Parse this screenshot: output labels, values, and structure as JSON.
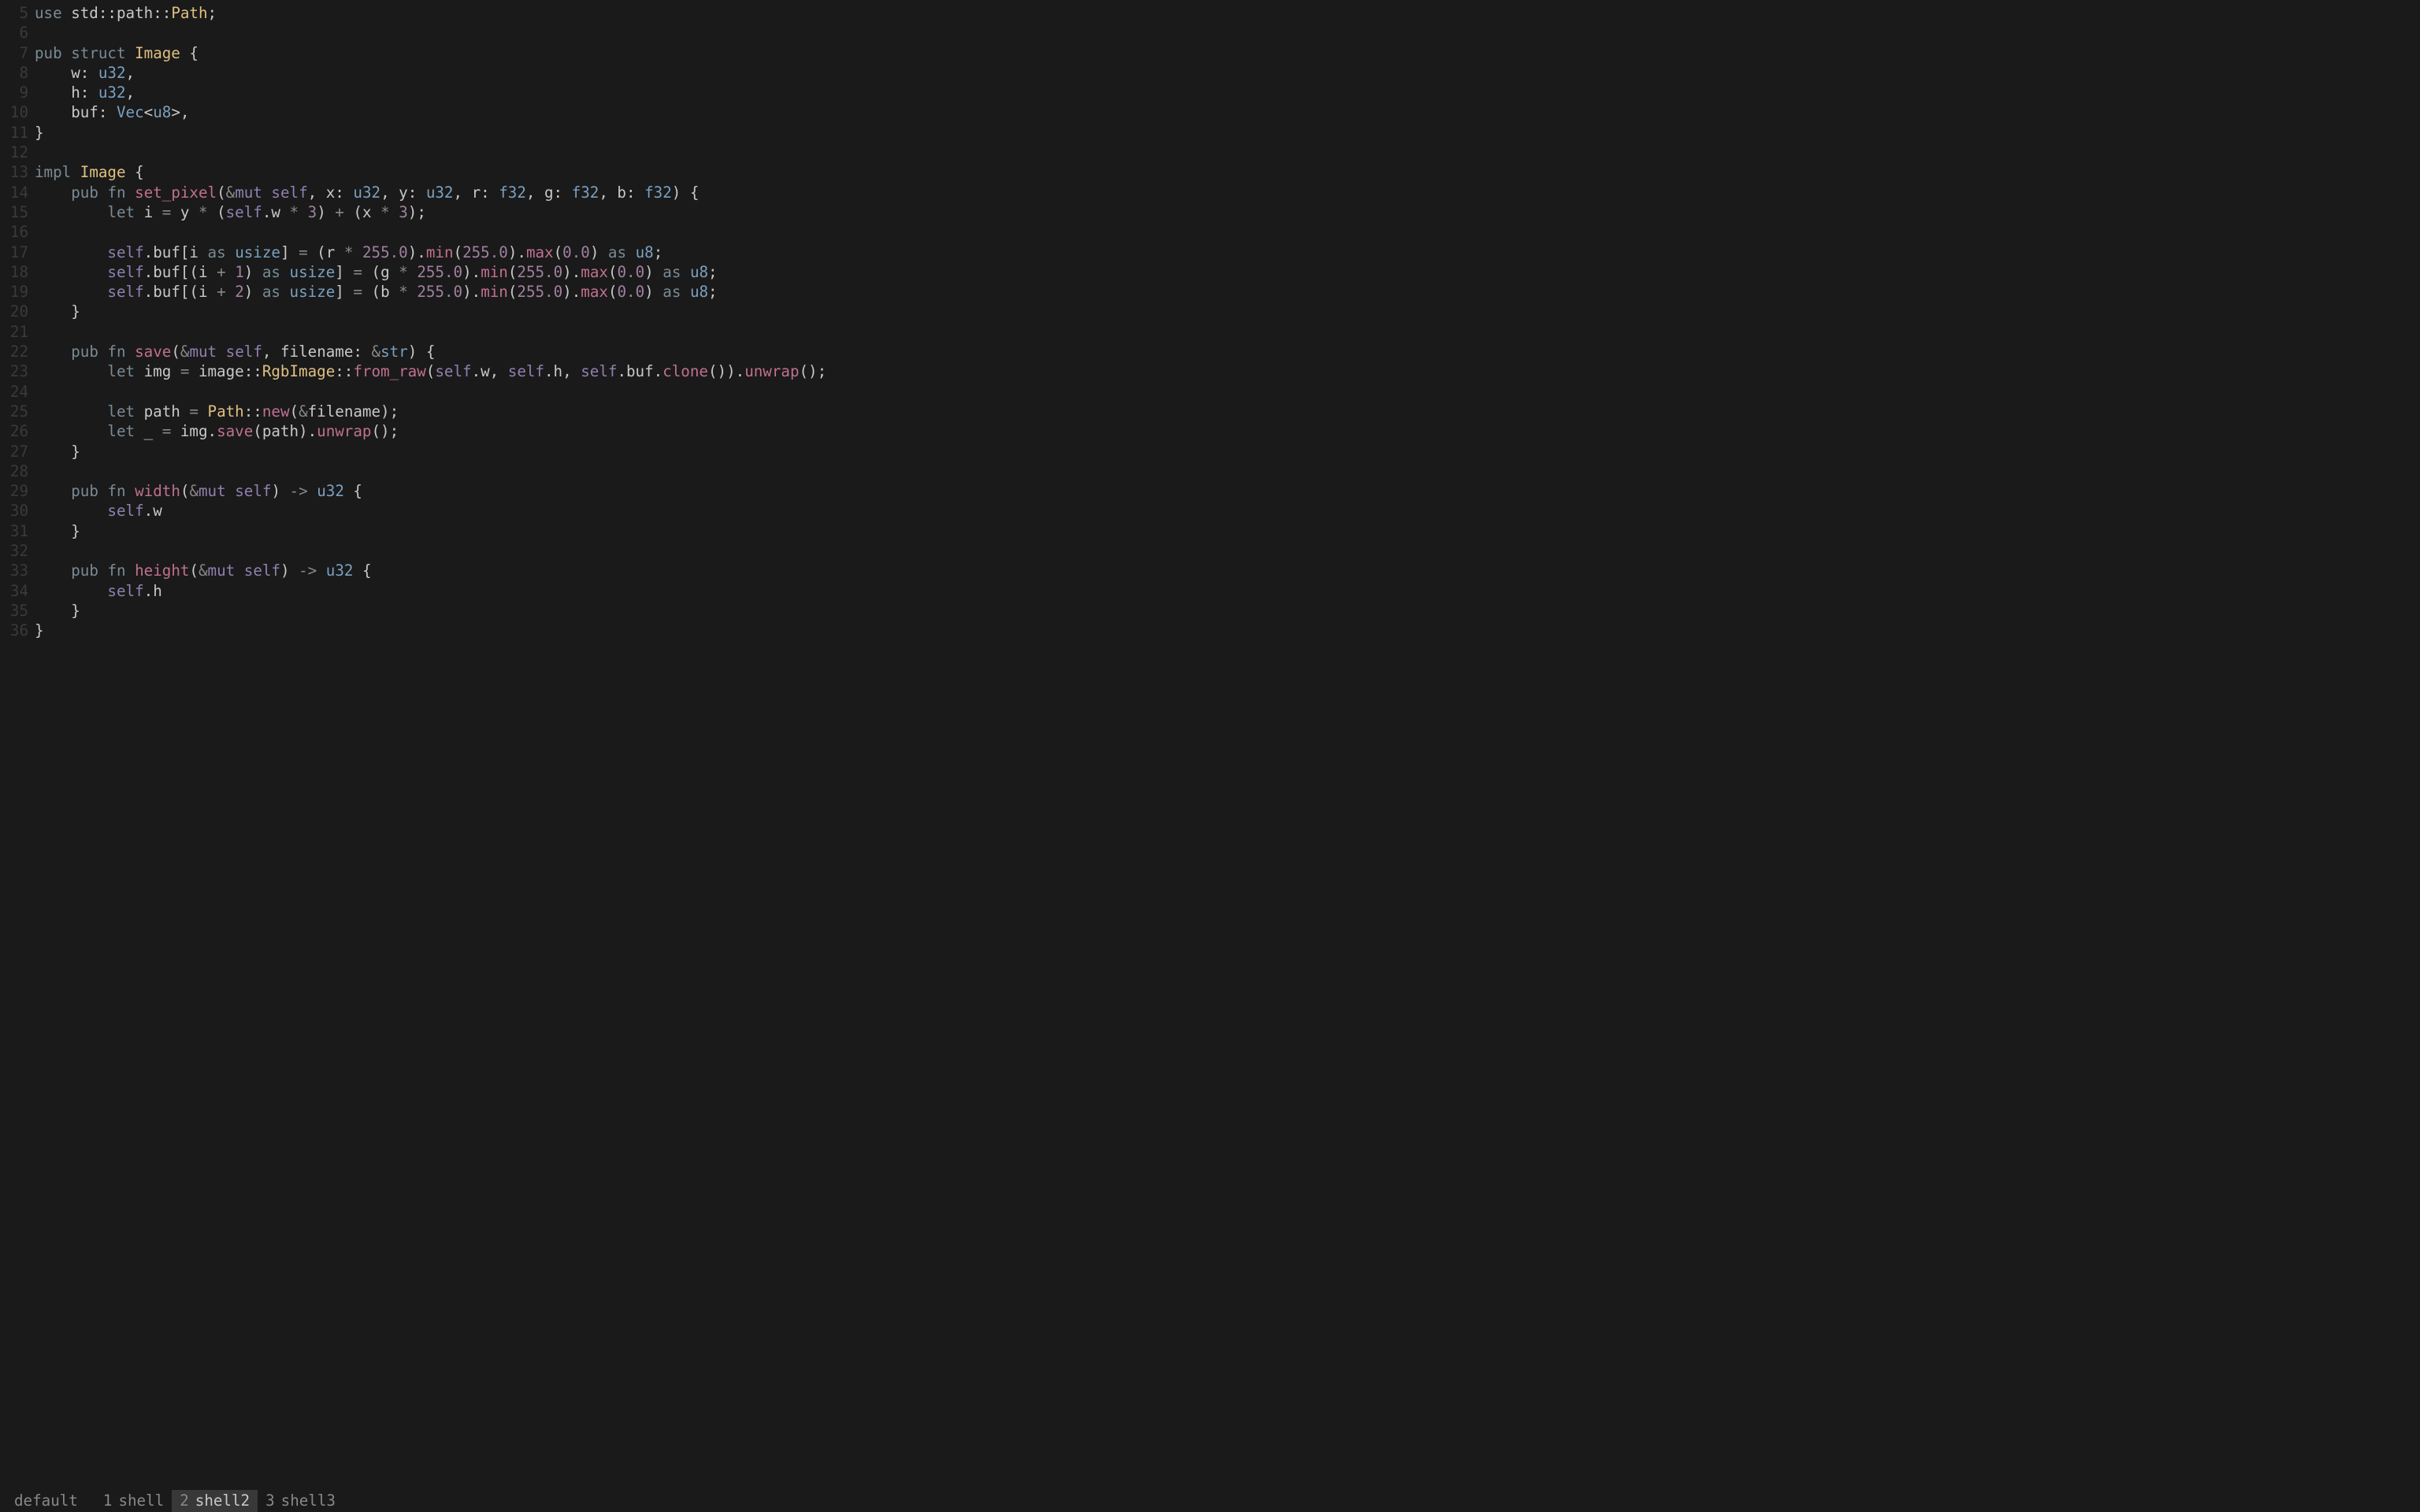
{
  "statusbar": {
    "session": "default",
    "tabs": [
      {
        "index": "1",
        "name": "shell",
        "active": false
      },
      {
        "index": "2",
        "name": "shell2",
        "active": true
      },
      {
        "index": "3",
        "name": "shell3",
        "active": false
      }
    ]
  },
  "code": {
    "first_line_number": 5,
    "lines": [
      [
        {
          "c": "kw",
          "t": "use"
        },
        {
          "c": "punct",
          "t": " std"
        },
        {
          "c": "path",
          "t": "::"
        },
        {
          "c": "punct",
          "t": "path"
        },
        {
          "c": "path",
          "t": "::"
        },
        {
          "c": "ty",
          "t": "Path"
        },
        {
          "c": "punct",
          "t": ";"
        }
      ],
      [],
      [
        {
          "c": "kw",
          "t": "pub"
        },
        {
          "c": "punct",
          "t": " "
        },
        {
          "c": "kw",
          "t": "struct"
        },
        {
          "c": "punct",
          "t": " "
        },
        {
          "c": "ty",
          "t": "Image"
        },
        {
          "c": "punct",
          "t": " {"
        }
      ],
      [
        {
          "c": "punct",
          "t": "    w"
        },
        {
          "c": "punct",
          "t": ": "
        },
        {
          "c": "prim",
          "t": "u32"
        },
        {
          "c": "punct",
          "t": ","
        }
      ],
      [
        {
          "c": "punct",
          "t": "    h"
        },
        {
          "c": "punct",
          "t": ": "
        },
        {
          "c": "prim",
          "t": "u32"
        },
        {
          "c": "punct",
          "t": ","
        }
      ],
      [
        {
          "c": "punct",
          "t": "    buf"
        },
        {
          "c": "punct",
          "t": ": "
        },
        {
          "c": "prim",
          "t": "Vec"
        },
        {
          "c": "punct",
          "t": "<"
        },
        {
          "c": "prim",
          "t": "u8"
        },
        {
          "c": "punct",
          "t": ">,"
        }
      ],
      [
        {
          "c": "punct",
          "t": "}"
        }
      ],
      [],
      [
        {
          "c": "kw",
          "t": "impl"
        },
        {
          "c": "punct",
          "t": " "
        },
        {
          "c": "ty",
          "t": "Image"
        },
        {
          "c": "punct",
          "t": " {"
        }
      ],
      [
        {
          "c": "punct",
          "t": "    "
        },
        {
          "c": "kw",
          "t": "pub"
        },
        {
          "c": "punct",
          "t": " "
        },
        {
          "c": "kw",
          "t": "fn"
        },
        {
          "c": "punct",
          "t": " "
        },
        {
          "c": "fnname",
          "t": "set_pixel"
        },
        {
          "c": "punct",
          "t": "("
        },
        {
          "c": "amp",
          "t": "&"
        },
        {
          "c": "refm",
          "t": "mut"
        },
        {
          "c": "punct",
          "t": " "
        },
        {
          "c": "refm",
          "t": "self"
        },
        {
          "c": "punct",
          "t": ", x: "
        },
        {
          "c": "prim",
          "t": "u32"
        },
        {
          "c": "punct",
          "t": ", y: "
        },
        {
          "c": "prim",
          "t": "u32"
        },
        {
          "c": "punct",
          "t": ", r: "
        },
        {
          "c": "prim",
          "t": "f32"
        },
        {
          "c": "punct",
          "t": ", g: "
        },
        {
          "c": "prim",
          "t": "f32"
        },
        {
          "c": "punct",
          "t": ", b: "
        },
        {
          "c": "prim",
          "t": "f32"
        },
        {
          "c": "punct",
          "t": ") {"
        }
      ],
      [
        {
          "c": "punct",
          "t": "        "
        },
        {
          "c": "kw",
          "t": "let"
        },
        {
          "c": "punct",
          "t": " i "
        },
        {
          "c": "op",
          "t": "="
        },
        {
          "c": "punct",
          "t": " y "
        },
        {
          "c": "op",
          "t": "*"
        },
        {
          "c": "punct",
          "t": " ("
        },
        {
          "c": "refm",
          "t": "self"
        },
        {
          "c": "punct",
          "t": ".w "
        },
        {
          "c": "op",
          "t": "*"
        },
        {
          "c": "punct",
          "t": " "
        },
        {
          "c": "num",
          "t": "3"
        },
        {
          "c": "punct",
          "t": ") "
        },
        {
          "c": "op",
          "t": "+"
        },
        {
          "c": "punct",
          "t": " (x "
        },
        {
          "c": "op",
          "t": "*"
        },
        {
          "c": "punct",
          "t": " "
        },
        {
          "c": "num",
          "t": "3"
        },
        {
          "c": "punct",
          "t": ");"
        }
      ],
      [],
      [
        {
          "c": "punct",
          "t": "        "
        },
        {
          "c": "refm",
          "t": "self"
        },
        {
          "c": "punct",
          "t": ".buf[i "
        },
        {
          "c": "kw",
          "t": "as"
        },
        {
          "c": "punct",
          "t": " "
        },
        {
          "c": "prim",
          "t": "usize"
        },
        {
          "c": "punct",
          "t": "] "
        },
        {
          "c": "op",
          "t": "="
        },
        {
          "c": "punct",
          "t": " (r "
        },
        {
          "c": "op",
          "t": "*"
        },
        {
          "c": "punct",
          "t": " "
        },
        {
          "c": "num",
          "t": "255.0"
        },
        {
          "c": "punct",
          "t": ")."
        },
        {
          "c": "fnname",
          "t": "min"
        },
        {
          "c": "punct",
          "t": "("
        },
        {
          "c": "num",
          "t": "255.0"
        },
        {
          "c": "punct",
          "t": ")."
        },
        {
          "c": "fnname",
          "t": "max"
        },
        {
          "c": "punct",
          "t": "("
        },
        {
          "c": "num",
          "t": "0.0"
        },
        {
          "c": "punct",
          "t": ") "
        },
        {
          "c": "kw",
          "t": "as"
        },
        {
          "c": "punct",
          "t": " "
        },
        {
          "c": "prim",
          "t": "u8"
        },
        {
          "c": "punct",
          "t": ";"
        }
      ],
      [
        {
          "c": "punct",
          "t": "        "
        },
        {
          "c": "refm",
          "t": "self"
        },
        {
          "c": "punct",
          "t": ".buf[(i "
        },
        {
          "c": "op",
          "t": "+"
        },
        {
          "c": "punct",
          "t": " "
        },
        {
          "c": "num",
          "t": "1"
        },
        {
          "c": "punct",
          "t": ") "
        },
        {
          "c": "kw",
          "t": "as"
        },
        {
          "c": "punct",
          "t": " "
        },
        {
          "c": "prim",
          "t": "usize"
        },
        {
          "c": "punct",
          "t": "] "
        },
        {
          "c": "op",
          "t": "="
        },
        {
          "c": "punct",
          "t": " (g "
        },
        {
          "c": "op",
          "t": "*"
        },
        {
          "c": "punct",
          "t": " "
        },
        {
          "c": "num",
          "t": "255.0"
        },
        {
          "c": "punct",
          "t": ")."
        },
        {
          "c": "fnname",
          "t": "min"
        },
        {
          "c": "punct",
          "t": "("
        },
        {
          "c": "num",
          "t": "255.0"
        },
        {
          "c": "punct",
          "t": ")."
        },
        {
          "c": "fnname",
          "t": "max"
        },
        {
          "c": "punct",
          "t": "("
        },
        {
          "c": "num",
          "t": "0.0"
        },
        {
          "c": "punct",
          "t": ") "
        },
        {
          "c": "kw",
          "t": "as"
        },
        {
          "c": "punct",
          "t": " "
        },
        {
          "c": "prim",
          "t": "u8"
        },
        {
          "c": "punct",
          "t": ";"
        }
      ],
      [
        {
          "c": "punct",
          "t": "        "
        },
        {
          "c": "refm",
          "t": "self"
        },
        {
          "c": "punct",
          "t": ".buf[(i "
        },
        {
          "c": "op",
          "t": "+"
        },
        {
          "c": "punct",
          "t": " "
        },
        {
          "c": "num",
          "t": "2"
        },
        {
          "c": "punct",
          "t": ") "
        },
        {
          "c": "kw",
          "t": "as"
        },
        {
          "c": "punct",
          "t": " "
        },
        {
          "c": "prim",
          "t": "usize"
        },
        {
          "c": "punct",
          "t": "] "
        },
        {
          "c": "op",
          "t": "="
        },
        {
          "c": "punct",
          "t": " (b "
        },
        {
          "c": "op",
          "t": "*"
        },
        {
          "c": "punct",
          "t": " "
        },
        {
          "c": "num",
          "t": "255.0"
        },
        {
          "c": "punct",
          "t": ")."
        },
        {
          "c": "fnname",
          "t": "min"
        },
        {
          "c": "punct",
          "t": "("
        },
        {
          "c": "num",
          "t": "255.0"
        },
        {
          "c": "punct",
          "t": ")."
        },
        {
          "c": "fnname",
          "t": "max"
        },
        {
          "c": "punct",
          "t": "("
        },
        {
          "c": "num",
          "t": "0.0"
        },
        {
          "c": "punct",
          "t": ") "
        },
        {
          "c": "kw",
          "t": "as"
        },
        {
          "c": "punct",
          "t": " "
        },
        {
          "c": "prim",
          "t": "u8"
        },
        {
          "c": "punct",
          "t": ";"
        }
      ],
      [
        {
          "c": "punct",
          "t": "    }"
        }
      ],
      [],
      [
        {
          "c": "punct",
          "t": "    "
        },
        {
          "c": "kw",
          "t": "pub"
        },
        {
          "c": "punct",
          "t": " "
        },
        {
          "c": "kw",
          "t": "fn"
        },
        {
          "c": "punct",
          "t": " "
        },
        {
          "c": "fnname",
          "t": "save"
        },
        {
          "c": "punct",
          "t": "("
        },
        {
          "c": "amp",
          "t": "&"
        },
        {
          "c": "refm",
          "t": "mut"
        },
        {
          "c": "punct",
          "t": " "
        },
        {
          "c": "refm",
          "t": "self"
        },
        {
          "c": "punct",
          "t": ", filename: "
        },
        {
          "c": "amp",
          "t": "&"
        },
        {
          "c": "prim",
          "t": "str"
        },
        {
          "c": "punct",
          "t": ") {"
        }
      ],
      [
        {
          "c": "punct",
          "t": "        "
        },
        {
          "c": "kw",
          "t": "let"
        },
        {
          "c": "punct",
          "t": " img "
        },
        {
          "c": "op",
          "t": "="
        },
        {
          "c": "punct",
          "t": " image"
        },
        {
          "c": "path",
          "t": "::"
        },
        {
          "c": "ty",
          "t": "RgbImage"
        },
        {
          "c": "path",
          "t": "::"
        },
        {
          "c": "fnname",
          "t": "from_raw"
        },
        {
          "c": "punct",
          "t": "("
        },
        {
          "c": "refm",
          "t": "self"
        },
        {
          "c": "punct",
          "t": ".w, "
        },
        {
          "c": "refm",
          "t": "self"
        },
        {
          "c": "punct",
          "t": ".h, "
        },
        {
          "c": "refm",
          "t": "self"
        },
        {
          "c": "punct",
          "t": ".buf."
        },
        {
          "c": "fnname",
          "t": "clone"
        },
        {
          "c": "punct",
          "t": "())."
        },
        {
          "c": "fnname",
          "t": "unwrap"
        },
        {
          "c": "punct",
          "t": "();"
        }
      ],
      [],
      [
        {
          "c": "punct",
          "t": "        "
        },
        {
          "c": "kw",
          "t": "let"
        },
        {
          "c": "punct",
          "t": " path "
        },
        {
          "c": "op",
          "t": "="
        },
        {
          "c": "punct",
          "t": " "
        },
        {
          "c": "ty",
          "t": "Path"
        },
        {
          "c": "path",
          "t": "::"
        },
        {
          "c": "fnname",
          "t": "new"
        },
        {
          "c": "punct",
          "t": "("
        },
        {
          "c": "amp",
          "t": "&"
        },
        {
          "c": "punct",
          "t": "filename);"
        }
      ],
      [
        {
          "c": "punct",
          "t": "        "
        },
        {
          "c": "kw",
          "t": "let"
        },
        {
          "c": "punct",
          "t": " _ "
        },
        {
          "c": "op",
          "t": "="
        },
        {
          "c": "punct",
          "t": " img."
        },
        {
          "c": "fnname",
          "t": "save"
        },
        {
          "c": "punct",
          "t": "(path)."
        },
        {
          "c": "fnname",
          "t": "unwrap"
        },
        {
          "c": "punct",
          "t": "();"
        }
      ],
      [
        {
          "c": "punct",
          "t": "    }"
        }
      ],
      [],
      [
        {
          "c": "punct",
          "t": "    "
        },
        {
          "c": "kw",
          "t": "pub"
        },
        {
          "c": "punct",
          "t": " "
        },
        {
          "c": "kw",
          "t": "fn"
        },
        {
          "c": "punct",
          "t": " "
        },
        {
          "c": "fnname",
          "t": "width"
        },
        {
          "c": "punct",
          "t": "("
        },
        {
          "c": "amp",
          "t": "&"
        },
        {
          "c": "refm",
          "t": "mut"
        },
        {
          "c": "punct",
          "t": " "
        },
        {
          "c": "refm",
          "t": "self"
        },
        {
          "c": "punct",
          "t": ") "
        },
        {
          "c": "op",
          "t": "->"
        },
        {
          "c": "punct",
          "t": " "
        },
        {
          "c": "prim",
          "t": "u32"
        },
        {
          "c": "punct",
          "t": " {"
        }
      ],
      [
        {
          "c": "punct",
          "t": "        "
        },
        {
          "c": "refm",
          "t": "self"
        },
        {
          "c": "punct",
          "t": ".w"
        }
      ],
      [
        {
          "c": "punct",
          "t": "    }"
        }
      ],
      [],
      [
        {
          "c": "punct",
          "t": "    "
        },
        {
          "c": "kw",
          "t": "pub"
        },
        {
          "c": "punct",
          "t": " "
        },
        {
          "c": "kw",
          "t": "fn"
        },
        {
          "c": "punct",
          "t": " "
        },
        {
          "c": "fnname",
          "t": "height"
        },
        {
          "c": "punct",
          "t": "("
        },
        {
          "c": "amp",
          "t": "&"
        },
        {
          "c": "refm",
          "t": "mut"
        },
        {
          "c": "punct",
          "t": " "
        },
        {
          "c": "refm",
          "t": "self"
        },
        {
          "c": "punct",
          "t": ") "
        },
        {
          "c": "op",
          "t": "->"
        },
        {
          "c": "punct",
          "t": " "
        },
        {
          "c": "prim",
          "t": "u32"
        },
        {
          "c": "punct",
          "t": " {"
        }
      ],
      [
        {
          "c": "punct",
          "t": "        "
        },
        {
          "c": "refm",
          "t": "self"
        },
        {
          "c": "punct",
          "t": ".h"
        }
      ],
      [
        {
          "c": "punct",
          "t": "    }"
        }
      ],
      [
        {
          "c": "punct",
          "t": "}"
        }
      ]
    ]
  }
}
